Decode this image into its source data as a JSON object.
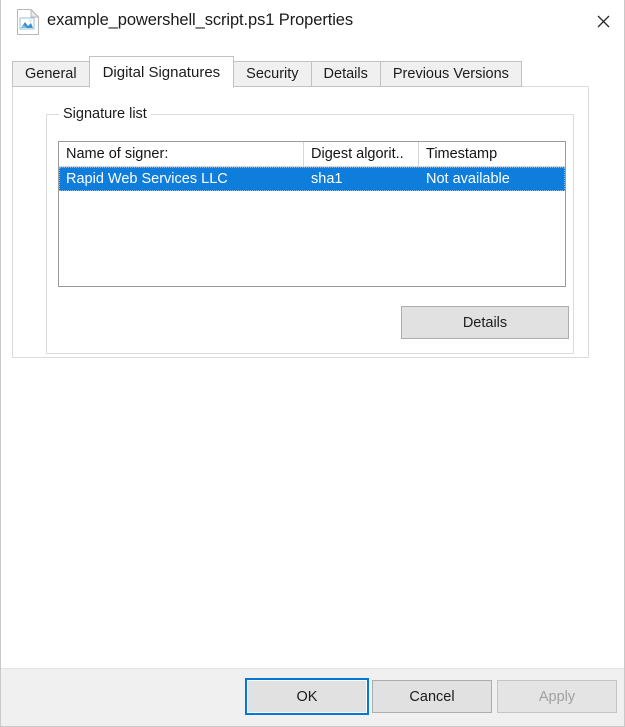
{
  "window": {
    "title": "example_powershell_script.ps1 Properties",
    "icon": "file-script-icon",
    "close_label": "✕"
  },
  "tabs": [
    {
      "label": "General",
      "active": false
    },
    {
      "label": "Digital Signatures",
      "active": true
    },
    {
      "label": "Security",
      "active": false
    },
    {
      "label": "Details",
      "active": false
    },
    {
      "label": "Previous Versions",
      "active": false
    }
  ],
  "signature_group": {
    "legend": "Signature list",
    "columns": [
      "Name of signer:",
      "Digest algorit..",
      "Timestamp"
    ],
    "rows": [
      {
        "name_of_signer": "Rapid Web Services LLC",
        "digest_algorithm": "sha1",
        "timestamp": "Not available",
        "selected": true
      }
    ],
    "details_button": "Details"
  },
  "footer": {
    "ok": "OK",
    "cancel": "Cancel",
    "apply": "Apply"
  },
  "colors": {
    "selection_blue": "#0f7ddb",
    "focus_blue": "#0078d7",
    "button_face": "#e1e1e1",
    "dialog_bar": "#f0f0f0",
    "disabled_text": "#a0a0a0"
  }
}
